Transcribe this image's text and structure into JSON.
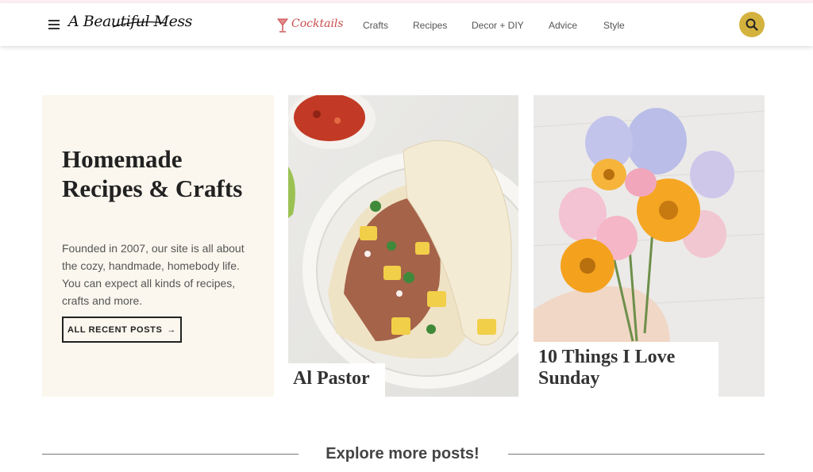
{
  "header": {
    "logo_text": "A Beautiful Mess",
    "nav": {
      "cocktails": "Cocktails",
      "items": [
        "Crafts",
        "Recipes",
        "Decor + DIY",
        "Advice",
        "Style"
      ]
    },
    "icons": {
      "menu": "hamburger-menu-icon",
      "cocktail": "cocktail-glass-icon",
      "search": "search-icon"
    }
  },
  "hero": {
    "title": "Homemade Recipes & Crafts",
    "description": "Founded in 2007, our site is all about the cozy, handmade, homebody life. You can expect all kinds of recipes, crafts and more.",
    "button_label": "ALL RECENT POSTS",
    "button_arrow": "→"
  },
  "tiles": [
    {
      "label": "Al Pastor"
    },
    {
      "label": "10 Things I Love Sunday"
    }
  ],
  "explore": {
    "title": "Explore more posts!"
  },
  "colors": {
    "accent_search": "#d4b23e",
    "cocktails_text": "#c94c4c",
    "hero_background": "#fbf7ee"
  }
}
